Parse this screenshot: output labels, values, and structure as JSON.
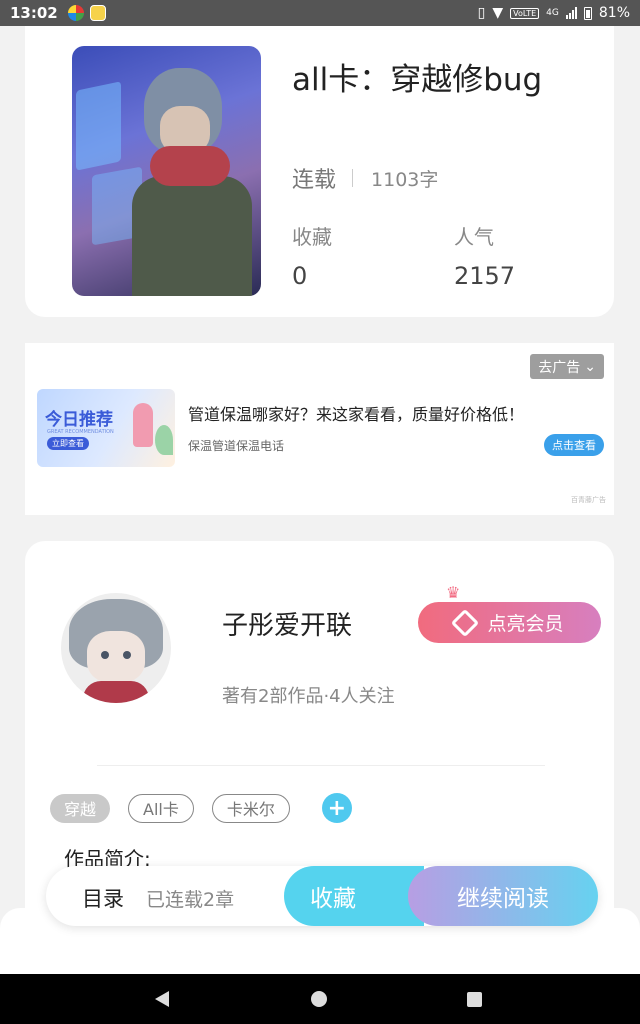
{
  "status_bar": {
    "time": "13:02",
    "volte": "VoLTE",
    "network": "4G",
    "battery": "81%"
  },
  "book": {
    "title": "all卡：穿越修bug",
    "status": "连载",
    "word_count": "1103字",
    "favorites_label": "收藏",
    "favorites_value": "0",
    "popularity_label": "人气",
    "popularity_value": "2157"
  },
  "ad": {
    "close_label": "去广告",
    "image_title": "今日推荐",
    "image_sub": "GREAT RECOMMENDATION",
    "image_button": "立即查看",
    "title": "管道保温哪家好？来这家看看，质量好价格低！",
    "subtitle": "保温管道保温电话",
    "cta": "点击查看",
    "source": "百青藤广告"
  },
  "author": {
    "name": "子彤爱开联",
    "stats": "著有2部作品·4人关注",
    "vip_label": "点亮会员"
  },
  "tags": [
    "穿越",
    "All卡",
    "卡米尔"
  ],
  "intro_label": "作品简介:",
  "action_bar": {
    "toc": "目录",
    "chapters": "已连载2章",
    "favorite": "收藏",
    "continue": "继续阅读"
  },
  "colors": {
    "accent": "#55d3ee",
    "vip_start": "#f16b7e",
    "vip_end": "#d77fbf"
  }
}
